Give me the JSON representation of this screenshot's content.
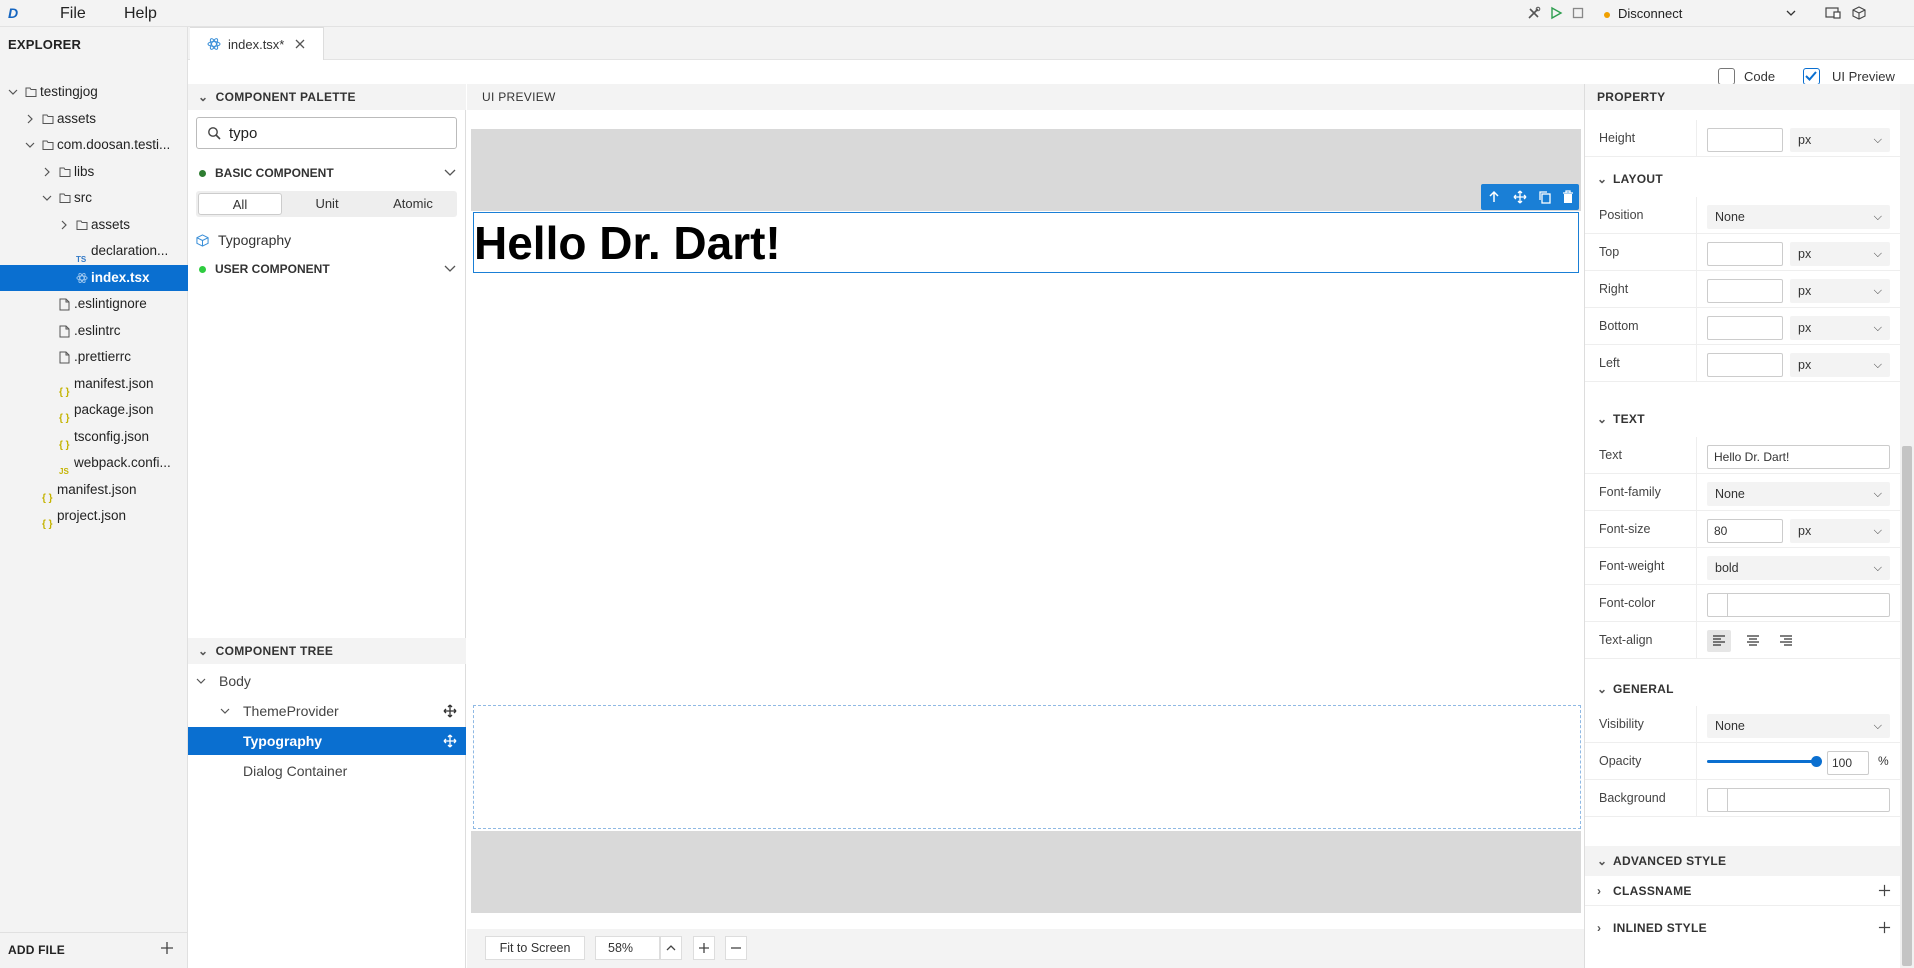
{
  "app": {
    "logo": "D",
    "menu": [
      "File",
      "Help"
    ],
    "connection": {
      "label": "Disconnect",
      "status_color": "#f0a000"
    }
  },
  "explorer": {
    "title": "EXPLORER",
    "tree": [
      {
        "label": "testingjog",
        "type": "folder",
        "depth": 0,
        "expanded": true
      },
      {
        "label": "assets",
        "type": "folder",
        "depth": 1,
        "expanded": false
      },
      {
        "label": "com.doosan.testi...",
        "type": "folder",
        "depth": 1,
        "expanded": true
      },
      {
        "label": "libs",
        "type": "folder",
        "depth": 2,
        "expanded": false
      },
      {
        "label": "src",
        "type": "folder",
        "depth": 2,
        "expanded": true
      },
      {
        "label": "assets",
        "type": "folder",
        "depth": 3,
        "expanded": false
      },
      {
        "label": "declaration...",
        "type": "ts",
        "depth": 3
      },
      {
        "label": "index.tsx",
        "type": "react",
        "depth": 3,
        "selected": true
      },
      {
        "label": ".eslintignore",
        "type": "file",
        "depth": 2
      },
      {
        "label": ".eslintrc",
        "type": "file",
        "depth": 2
      },
      {
        "label": ".prettierrc",
        "type": "file",
        "depth": 2
      },
      {
        "label": "manifest.json",
        "type": "json",
        "depth": 2
      },
      {
        "label": "package.json",
        "type": "json",
        "depth": 2
      },
      {
        "label": "tsconfig.json",
        "type": "json",
        "depth": 2
      },
      {
        "label": "webpack.confi...",
        "type": "js",
        "depth": 2
      },
      {
        "label": "manifest.json",
        "type": "json",
        "depth": 1
      },
      {
        "label": "project.json",
        "type": "json",
        "depth": 1
      }
    ],
    "add_file": "ADD FILE"
  },
  "editor": {
    "tab": {
      "label": "index.tsx*"
    },
    "view_toggles": {
      "code": "Code",
      "code_checked": false,
      "ui_preview": "UI Preview",
      "ui_preview_checked": true
    }
  },
  "palette": {
    "title": "COMPONENT PALETTE",
    "search_value": "typo",
    "basic": {
      "label": "BASIC COMPONENT",
      "dot_color": "#2e7d32"
    },
    "filters": [
      "All",
      "Unit",
      "Atomic"
    ],
    "active_filter": "All",
    "items": [
      "Typography"
    ],
    "user": {
      "label": "USER COMPONENT",
      "dot_color": "#2ecc40"
    }
  },
  "component_tree": {
    "title": "COMPONENT TREE",
    "nodes": [
      {
        "label": "Body",
        "depth": 0
      },
      {
        "label": "ThemeProvider",
        "depth": 1
      },
      {
        "label": "Typography",
        "depth": 2,
        "selected": true
      },
      {
        "label": "Dialog Container",
        "depth": 2
      }
    ]
  },
  "preview": {
    "title": "UI PREVIEW",
    "heading_text": "Hello Dr. Dart!",
    "fit_button": "Fit to Screen",
    "zoom": "58%",
    "accent": "#1a7fd6"
  },
  "property": {
    "title": "PROPERTY",
    "height": {
      "label": "Height",
      "value": "",
      "unit": "px"
    },
    "layout": {
      "title": "LAYOUT",
      "position": {
        "label": "Position",
        "value": "None"
      },
      "offsets": [
        {
          "label": "Top",
          "value": "",
          "unit": "px"
        },
        {
          "label": "Right",
          "value": "",
          "unit": "px"
        },
        {
          "label": "Bottom",
          "value": "",
          "unit": "px"
        },
        {
          "label": "Left",
          "value": "",
          "unit": "px"
        }
      ]
    },
    "text": {
      "title": "TEXT",
      "text": {
        "label": "Text",
        "value": "Hello Dr. Dart!"
      },
      "font_family": {
        "label": "Font-family",
        "value": "None"
      },
      "font_size": {
        "label": "Font-size",
        "value": "80",
        "unit": "px"
      },
      "font_weight": {
        "label": "Font-weight",
        "value": "bold"
      },
      "font_color": {
        "label": "Font-color"
      },
      "text_align": {
        "label": "Text-align"
      }
    },
    "general": {
      "title": "GENERAL",
      "visibility": {
        "label": "Visibility",
        "value": "None"
      },
      "opacity": {
        "label": "Opacity",
        "value": "100",
        "unit": "%",
        "fraction": 1.0
      },
      "background": {
        "label": "Background"
      }
    },
    "advanced": {
      "title": "ADVANCED STYLE",
      "classname": "CLASSNAME",
      "inlined": "INLINED STYLE"
    }
  }
}
